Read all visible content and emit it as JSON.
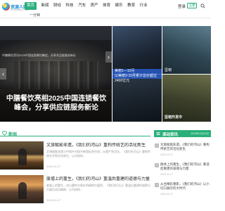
{
  "header": {
    "logo_text": "资源人网",
    "logo_sub": "ZIYUANREN.COM",
    "nav": [
      "首页",
      "新闻",
      "财经",
      "科技",
      "汽车",
      "房产",
      "体育",
      "娱乐",
      "教育",
      "行业",
      "汽车新闻",
      "实业公司",
      "汽车新体",
      "汽车新闻"
    ],
    "active_index": 0,
    "nav_row2": "一分钟",
    "login": "登录",
    "register": "注册",
    "icons": {
      "search": "search-icon",
      "logo": "logo-icon"
    }
  },
  "hero": {
    "caption": "中膳餐饮资讯2025中国连锁餐饮峰会，分享共品链服务新论",
    "title": "中膳餐饮亮相2025中国连锁餐饮峰会，分享供应链服务新论",
    "prev": "‹",
    "next": "›"
  },
  "tiles": [
    {
      "caption": ""
    },
    {
      "caption": ""
    },
    {
      "caption": "以美丽3-10月累计总价超过2400亿元"
    },
    {
      "caption": "坚韧开发中"
    }
  ],
  "blue_band": {
    "line1": "美丽1—10月",
    "line2": "以美丽3-10月累计总价超过2400亿元"
  },
  "tile4_badge": "坚韧",
  "news": {
    "label": "新闻",
    "articles": [
      {
        "title": "文旅赋能非遗，《我们的河山》重构传统艺的活化新生",
        "desc": "文旅赋能非遗与中国乡村振兴新国际合作进，从遗产到活化，《我们的河山》重构传统艺术到活化新生，以为结构...",
        "meta": "2024-11-17"
      },
      {
        "title": "废墟上的重生，《我们的河山》重温后重建的道德与力量",
        "desc": "废墟上的重生，也以重构为更好的精神力量是，《我们的河山》重温后重建的道德与力量后成功精神，以为结构...",
        "meta": "2024-11-17"
      }
    ]
  },
  "sidebar": {
    "label": "滚动资讯",
    "date": "2024年11月15日",
    "items": [
      {
        "num": "1",
        "title": "文旅赋能非遗，《我们的河山》重构传统艺的活化新生",
        "date": "2024-11-17"
      },
      {
        "num": "2",
        "title": "群体上的重生，《我们的河山》重温后重建的道德与力量",
        "date": "2024-11-17"
      },
      {
        "num": "3",
        "title": "从台精彩重影，《我们的河山》以小切口展示的大时代",
        "date": "2024-11-17"
      }
    ]
  },
  "colors": {
    "accent": "#2ab07a"
  }
}
